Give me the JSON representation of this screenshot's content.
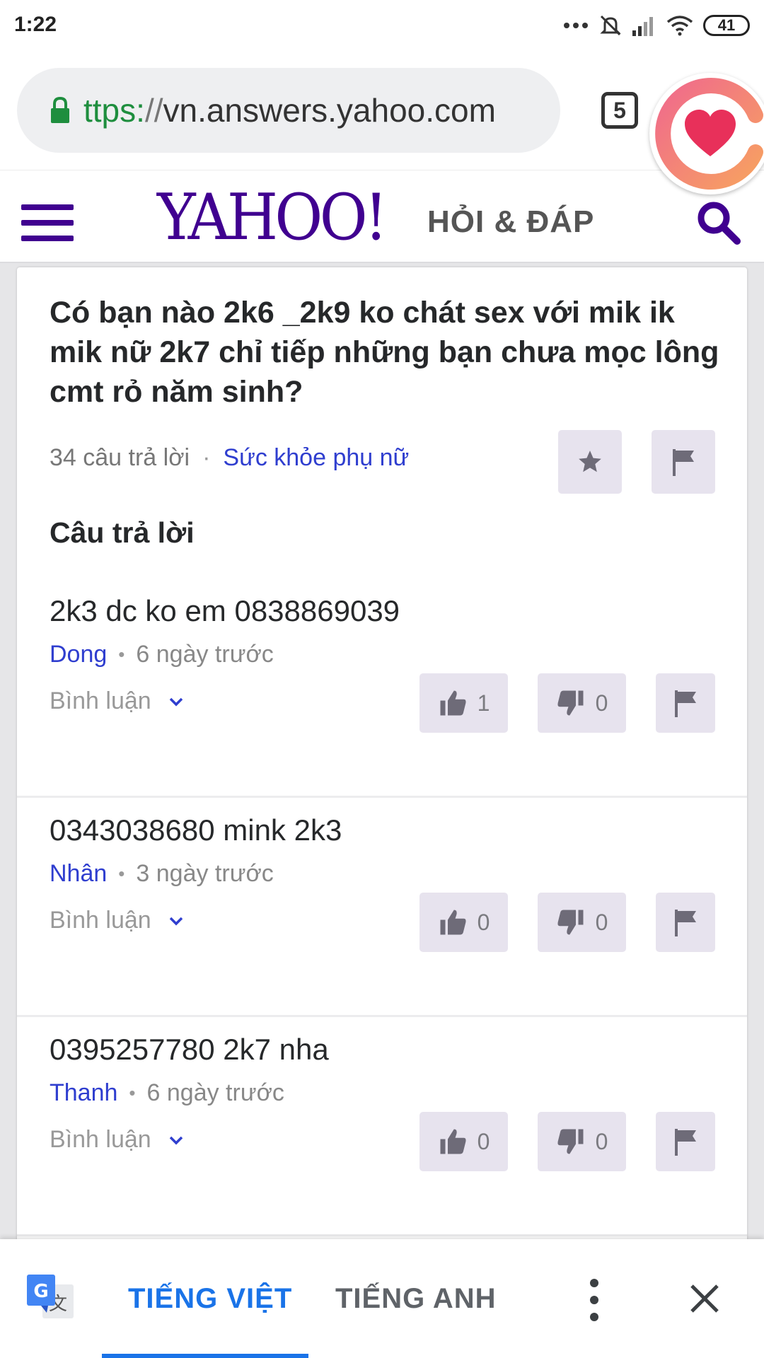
{
  "status_bar": {
    "time": "1:22",
    "battery": "41"
  },
  "browser": {
    "url_scheme": "ttps:",
    "url_sep": "//",
    "url_host": "vn.answers.yahoo.com",
    "tab_count": "5"
  },
  "header": {
    "logo": "YAHOO!",
    "subtitle": "HỎI & ĐÁP"
  },
  "question": {
    "title": "Có bạn nào 2k6 _2k9 ko chát sex với mik ik mik nữ 2k7 chỉ tiếp những bạn chưa mọc lông cmt rỏ năm sinh?",
    "answer_count": "34 câu trả lời",
    "category": "Sức khỏe phụ nữ"
  },
  "answers_heading": "Câu trả lời",
  "answers": [
    {
      "text": "2k3 dc ko em 0838869039",
      "author": "Dong",
      "time": "6 ngày trước",
      "comment_label": "Bình luận",
      "upvotes": "1",
      "downvotes": "0"
    },
    {
      "text": "0343038680 mink 2k3",
      "author": "Nhân",
      "time": "3 ngày trước",
      "comment_label": "Bình luận",
      "upvotes": "0",
      "downvotes": "0"
    },
    {
      "text": "0395257780 2k7 nha",
      "author": "Thanh",
      "time": "6 ngày trước",
      "comment_label": "Bình luận",
      "upvotes": "0",
      "downvotes": "0"
    }
  ],
  "translate_bar": {
    "source_lang": "TIẾNG VIỆT",
    "target_lang": "TIẾNG ANH"
  },
  "colors": {
    "yahoo_purple": "#400090",
    "link_blue": "#2f3ecf",
    "translate_blue": "#1a73e8",
    "button_bg": "#e7e3ee"
  },
  "icons": [
    "lock-icon",
    "menu-icon",
    "search-icon",
    "star-icon",
    "flag-icon",
    "thumbs-up-icon",
    "thumbs-down-icon",
    "chevron-down-icon",
    "google-translate-icon",
    "more-vert-icon",
    "close-icon",
    "chat-heart-icon"
  ]
}
